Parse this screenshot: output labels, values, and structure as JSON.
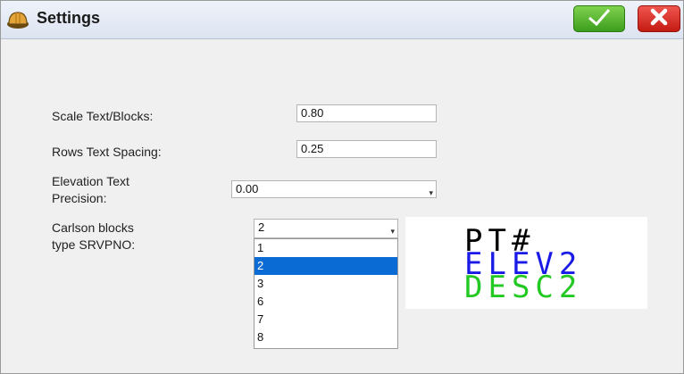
{
  "window": {
    "title": "Settings"
  },
  "icons": {
    "app": "hard-hat-icon",
    "ok": "checkmark-icon",
    "close": "x-icon"
  },
  "colors": {
    "ok_button": "#4fb22a",
    "close_button": "#e0302a",
    "selection": "#0a6bd4",
    "preview_line1": "#000000",
    "preview_line2": "#1a1ae6",
    "preview_line3": "#22c922"
  },
  "form": {
    "scale": {
      "label": "Scale Text/Blocks:",
      "value": "0.80"
    },
    "rows_spacing": {
      "label": "Rows Text Spacing:",
      "value": "0.25"
    },
    "elev_precision": {
      "label_line1": "Elevation Text",
      "label_line2": "Precision:",
      "value": "0.00"
    },
    "srvpno": {
      "label_line1": "Carlson blocks",
      "label_line2": "type SRVPNO:",
      "value": "2",
      "options": [
        "1",
        "2",
        "3",
        "6",
        "7",
        "8"
      ],
      "selected": "2"
    }
  },
  "preview": {
    "line1": "PT#",
    "line2": "ELEV2",
    "line3": "DESC2"
  }
}
